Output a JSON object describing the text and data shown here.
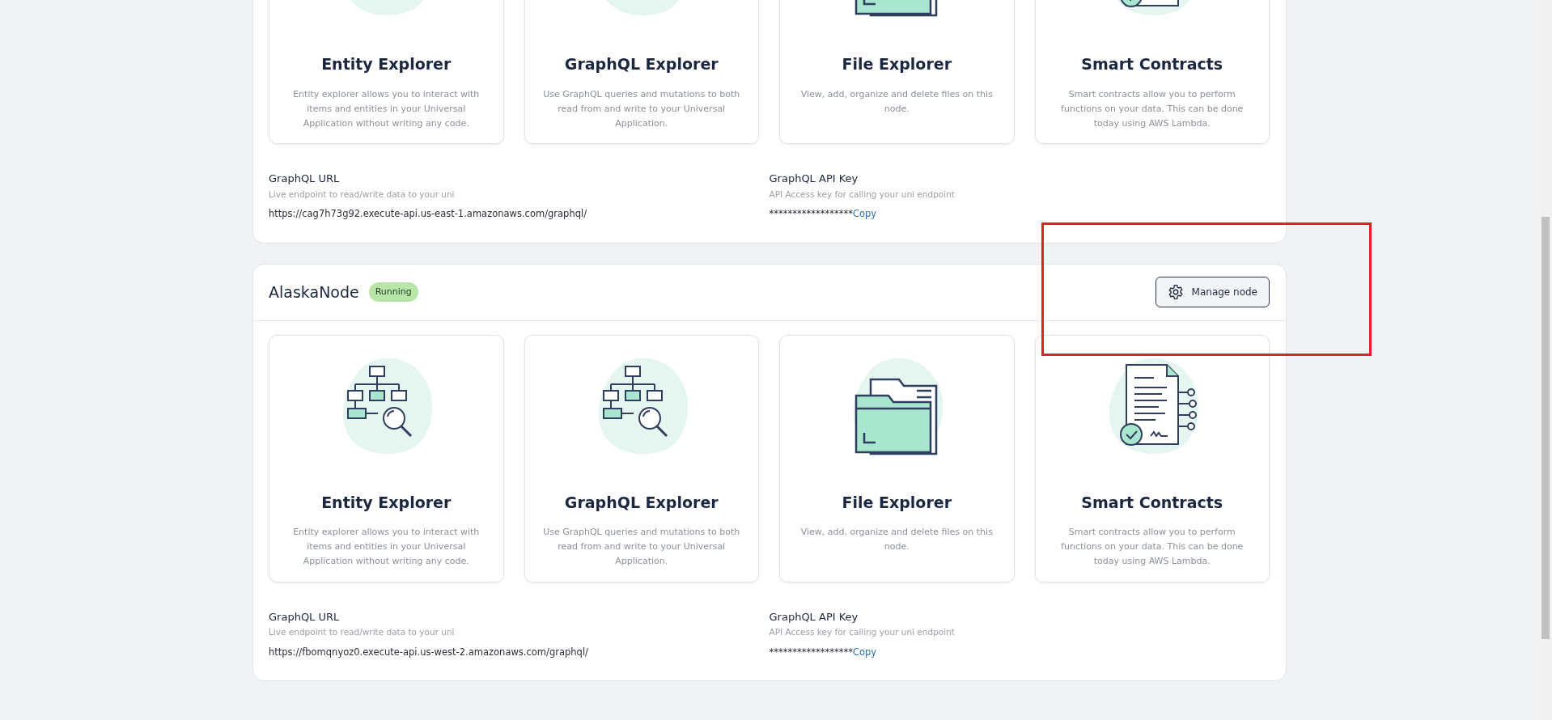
{
  "nodes": [
    {
      "tiles": [
        {
          "kind": "entity",
          "title": "Entity Explorer",
          "description": "Entity explorer allows you to interact with items and entities in your Universal Application without writing any code."
        },
        {
          "kind": "graphql",
          "title": "GraphQL Explorer",
          "description": "Use GraphQL queries and mutations to both read from and write to your Universal Application."
        },
        {
          "kind": "file",
          "title": "File Explorer",
          "description": "View, add, organize and delete files on this node."
        },
        {
          "kind": "contracts",
          "title": "Smart Contracts",
          "description": "Smart contracts allow you to perform functions on your data. This can be done today using AWS Lambda."
        }
      ],
      "endpoints": {
        "url_label": "GraphQL URL",
        "url_hint": "Live endpoint to read/write data to your uni",
        "url": "https://cag7h73g92.execute-api.us-east-1.amazonaws.com/graphql/",
        "key_label": "GraphQL API Key",
        "key_hint": "API Access key for calling your uni endpoint",
        "key": "******************",
        "copy": "Copy"
      }
    },
    {
      "name": "AlaskaNode",
      "status": "Running",
      "action": "Manage node",
      "tiles": [
        {
          "kind": "entity",
          "title": "Entity Explorer",
          "description": "Entity explorer allows you to interact with items and entities in your Universal Application without writing any code."
        },
        {
          "kind": "graphql",
          "title": "GraphQL Explorer",
          "description": "Use GraphQL queries and mutations to both read from and write to your Universal Application."
        },
        {
          "kind": "file",
          "title": "File Explorer",
          "description": "View, add, organize and delete files on this node."
        },
        {
          "kind": "contracts",
          "title": "Smart Contracts",
          "description": "Smart contracts allow you to perform functions on your data. This can be done today using AWS Lambda."
        }
      ],
      "endpoints": {
        "url_label": "GraphQL URL",
        "url_hint": "Live endpoint to read/write data to your uni",
        "url": "https://fbomqnyoz0.execute-api.us-west-2.amazonaws.com/graphql/",
        "key_label": "GraphQL API Key",
        "key_hint": "API Access key for calling your uni endpoint",
        "key": "******************",
        "copy": "Copy"
      }
    }
  ],
  "annotation": {
    "kind": "rectangle"
  }
}
